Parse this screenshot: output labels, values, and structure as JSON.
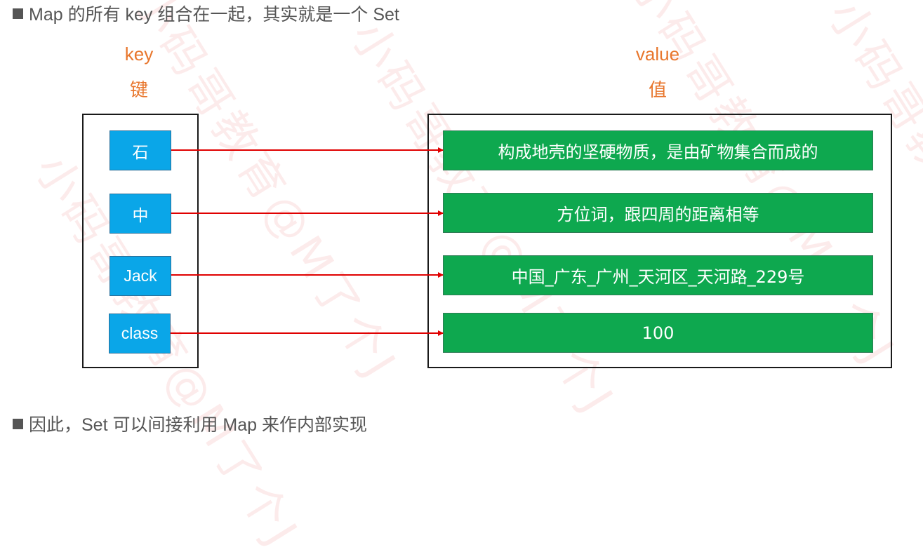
{
  "heading": {
    "bullet_icon": "square-bullet",
    "text": "Map 的所有 key 组合在一起，其实就是一个 Set"
  },
  "labels": {
    "key_en": "key",
    "key_zh": "键",
    "value_en": "value",
    "value_zh": "值"
  },
  "mappings": [
    {
      "key": "石",
      "value": "构成地壳的坚硬物质，是由矿物集合而成的"
    },
    {
      "key": "中",
      "value": "方位词，跟四周的距离相等"
    },
    {
      "key": "Jack",
      "value": "中国_广东_广州_天河区_天河路_229号"
    },
    {
      "key": "class",
      "value": "100"
    }
  ],
  "footer": {
    "bullet_icon": "square-bullet",
    "text": "因此，Set 可以间接利用 Map 来作内部实现"
  },
  "watermark": {
    "text": "小码哥教育@M了个J"
  },
  "colors": {
    "label_orange": "#e8762c",
    "key_blue": "#0aa6e8",
    "value_green": "#0ea84f",
    "arrow_red": "#e00000",
    "text_gray": "#555555"
  }
}
